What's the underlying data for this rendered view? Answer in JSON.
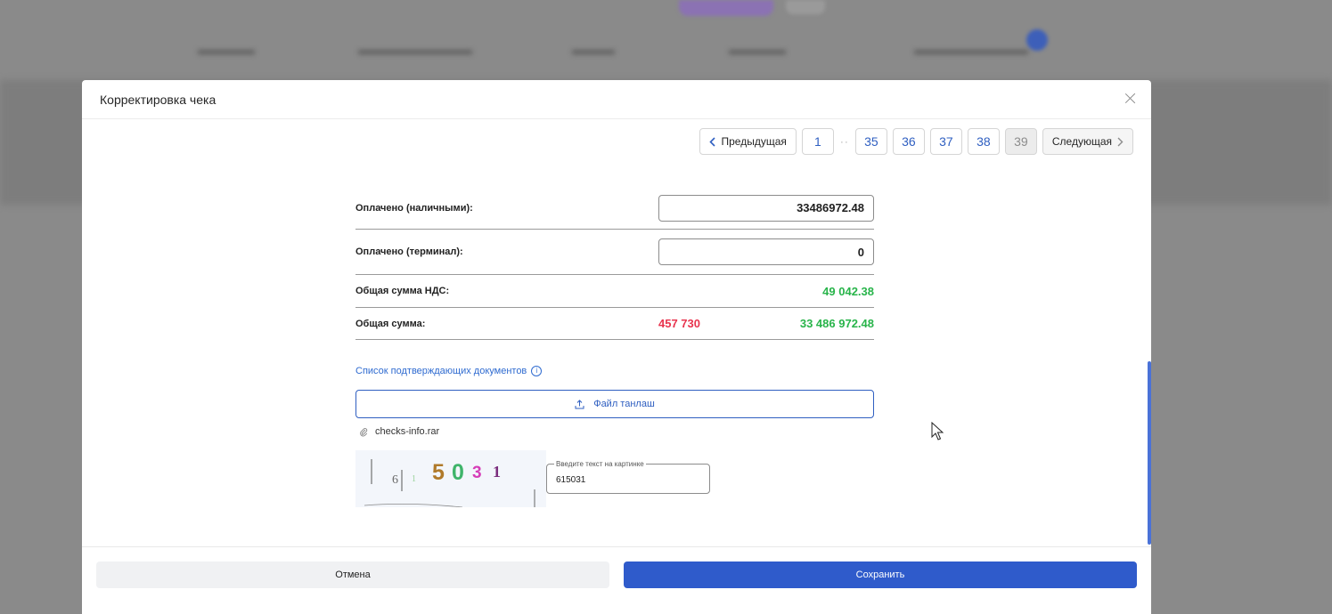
{
  "modal": {
    "title": "Корректировка чека"
  },
  "pagination": {
    "prev_label": "Предыдущая",
    "next_label": "Следующая",
    "pages": [
      "1",
      "35",
      "36",
      "37",
      "38",
      "39"
    ],
    "ellipsis": "··",
    "active_page": "39"
  },
  "form": {
    "cash_label": "Оплачено (наличными):",
    "cash_value": "33486972.48",
    "terminal_label": "Оплачено (терминал):",
    "terminal_value": "0",
    "vat_label": "Общая сумма НДС:",
    "vat_value": "49 042.38",
    "total_label": "Общая сумма:",
    "total_diff": "457 730",
    "total_value": "33 486 972.48"
  },
  "documents": {
    "link_label": "Список подтверждающих документов",
    "upload_label": "Файл танлаш",
    "file_name": "checks-info.rar"
  },
  "captcha": {
    "image_text": "615031",
    "field_label": "Введите текст на картинке",
    "field_value": "615031"
  },
  "footer": {
    "cancel_label": "Отмена",
    "save_label": "Сохранить"
  },
  "colors": {
    "accent": "#2f5bcb",
    "green": "#28b44a",
    "red": "#e8344e"
  }
}
